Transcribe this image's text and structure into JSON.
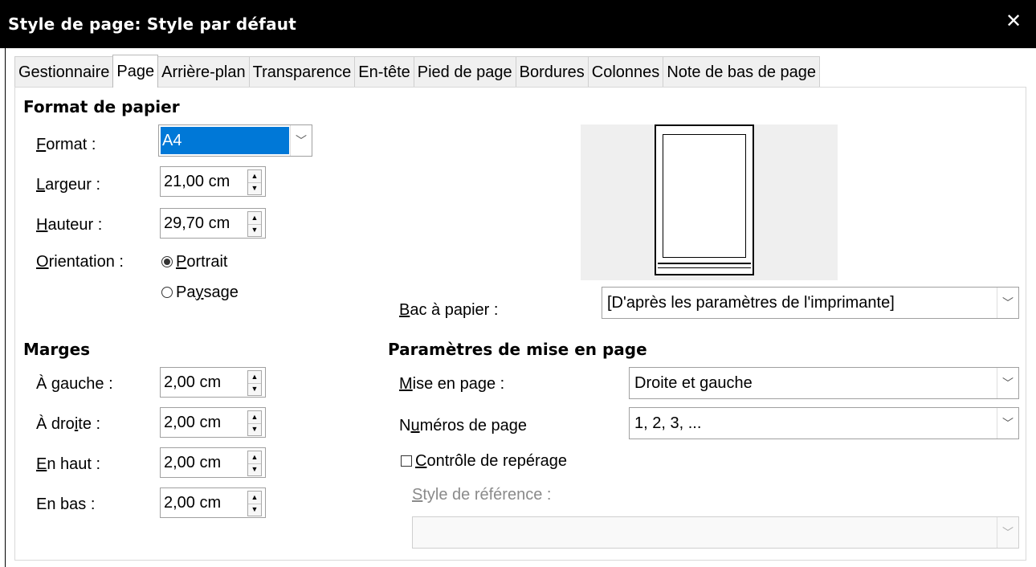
{
  "window": {
    "title": "Style de page: Style par défaut",
    "close_icon": "close-icon"
  },
  "tabs": [
    {
      "label": "Gestionnaire"
    },
    {
      "label": "Page",
      "active": true
    },
    {
      "label": "Arrière-plan"
    },
    {
      "label": "Transparence"
    },
    {
      "label": "En-tête"
    },
    {
      "label": "Pied de page"
    },
    {
      "label": "Bordures"
    },
    {
      "label": "Colonnes"
    },
    {
      "label": "Note de bas de page"
    }
  ],
  "paper_format": {
    "heading": "Format de papier",
    "format_label_a": "F",
    "format_label_b": "ormat :",
    "format_value": "A4",
    "width_label_a": "L",
    "width_label_b": "argeur :",
    "width_value": "21,00 cm",
    "height_label_a": "H",
    "height_label_b": "auteur :",
    "height_value": "29,70 cm",
    "orientation_label_a": "O",
    "orientation_label_b": "rientation :",
    "portrait_label_a": "P",
    "portrait_label_b": "ortrait",
    "landscape_label_a": "Pa",
    "landscape_label_u": "y",
    "landscape_label_b": "sage",
    "orientation_selected": "Portrait"
  },
  "paper_tray": {
    "label_a": "B",
    "label_b": "ac à papier :",
    "value": "[D'après les paramètres de l'imprimante]"
  },
  "margins": {
    "heading": "Marges",
    "left_label_a": "À ",
    "left_label_u": "g",
    "left_label_b": "auche :",
    "left_value": "2,00 cm",
    "right_label_a": "À dro",
    "right_label_u": "i",
    "right_label_b": "te :",
    "right_value": "2,00 cm",
    "top_label_a": "E",
    "top_label_b": "n haut :",
    "top_value": "2,00 cm",
    "bottom_label": "En bas :",
    "bottom_value": "2,00 cm"
  },
  "layout_settings": {
    "heading": "Paramètres de mise en page",
    "layout_label_a": "M",
    "layout_label_b": "ise en page :",
    "layout_value": "Droite et gauche",
    "numbers_label_a": "N",
    "numbers_label_u": "u",
    "numbers_label_b": "méros de page",
    "numbers_value": "1, 2, 3, ...",
    "register_label_a": "C",
    "register_label_b": "ontrôle de repérage",
    "register_checked": false,
    "reference_label_a": "S",
    "reference_label_b": "tyle de référence :",
    "reference_value": ""
  }
}
